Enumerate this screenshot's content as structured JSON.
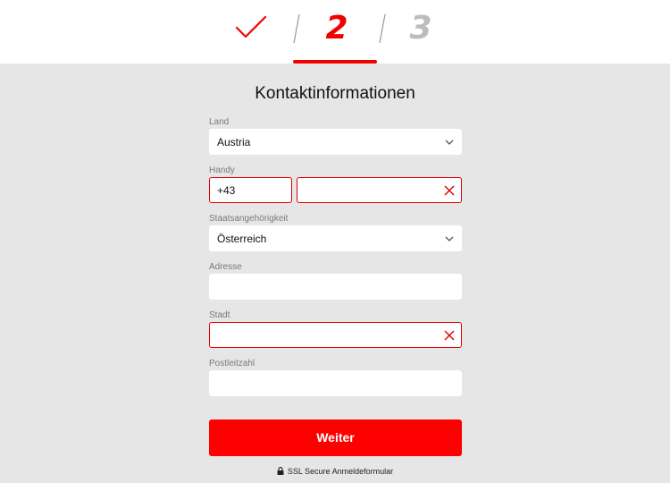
{
  "stepper": {
    "done_icon": "checkmark-icon",
    "current_step": "2",
    "next_step": "3"
  },
  "form": {
    "title": "Kontaktinformationen",
    "country": {
      "label": "Land",
      "value": "Austria"
    },
    "phone": {
      "label": "Handy",
      "prefix": "+43",
      "number": ""
    },
    "nationality": {
      "label": "Staatsangehörigkeit",
      "value": "Österreich"
    },
    "address": {
      "label": "Adresse",
      "value": ""
    },
    "city": {
      "label": "Stadt",
      "value": ""
    },
    "postal_code": {
      "label": "Postleitzahl",
      "value": ""
    },
    "submit_label": "Weiter",
    "secure_note": "SSL Secure Anmeldeformular"
  },
  "colors": {
    "accent": "#f20000",
    "error_border": "#e40000",
    "background": "#e6e6e6",
    "inactive_step": "#bdbdbd"
  }
}
